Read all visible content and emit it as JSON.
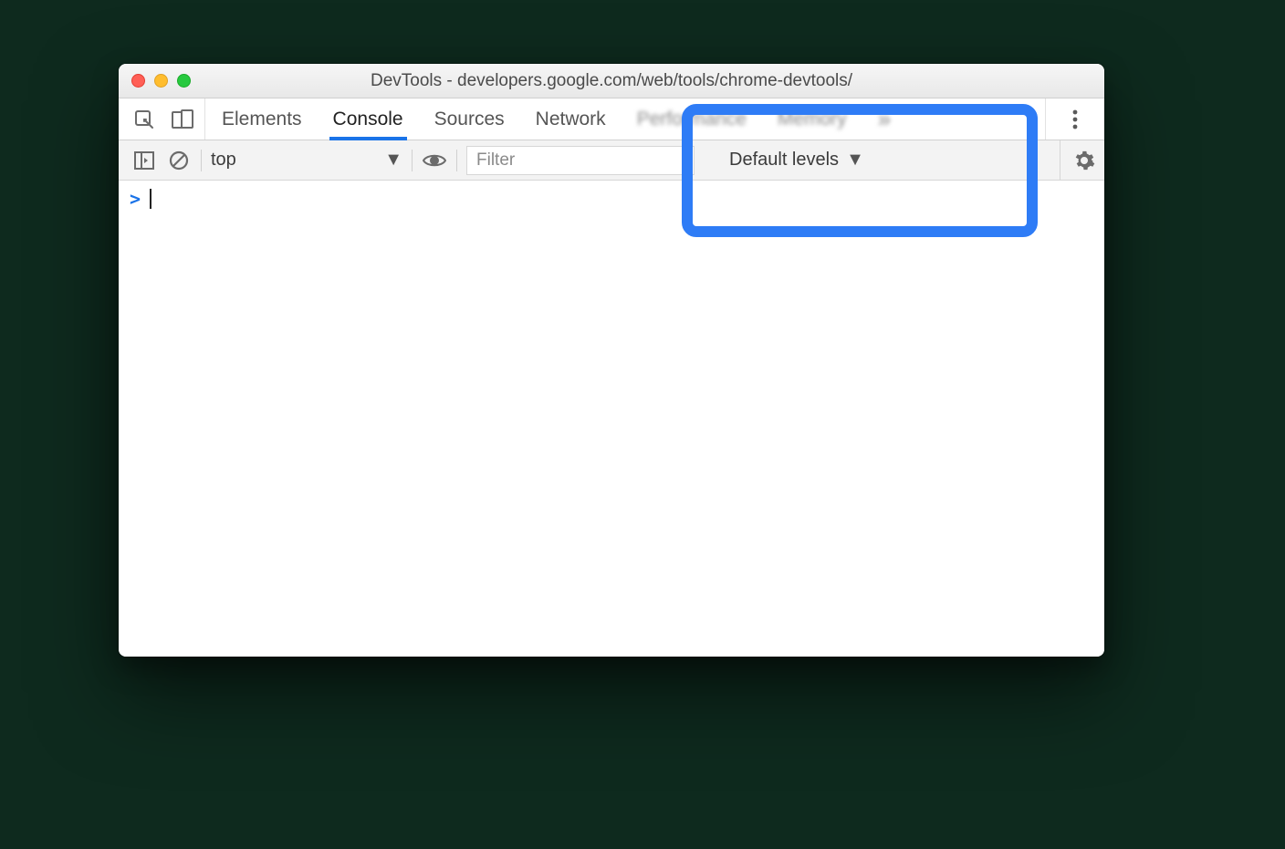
{
  "window": {
    "title": "DevTools - developers.google.com/web/tools/chrome-devtools/"
  },
  "tabs": {
    "elements": "Elements",
    "console": "Console",
    "sources": "Sources",
    "network": "Network",
    "performance": "Performance",
    "memory": "Memory"
  },
  "console_toolbar": {
    "context": "top",
    "filter_placeholder": "Filter",
    "levels": "Default levels"
  },
  "prompt": {
    "chevron": ">"
  }
}
